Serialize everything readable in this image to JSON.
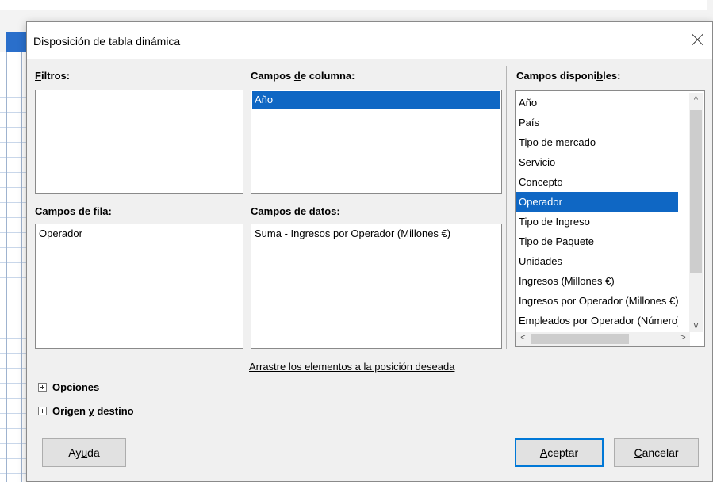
{
  "dialog": {
    "title": "Disposición de tabla dinámica",
    "close_label": "×"
  },
  "sections": {
    "filtros": {
      "pre": "",
      "u": "F",
      "post": "iltros:"
    },
    "columna": {
      "pre": "Campos ",
      "u": "d",
      "post": "e columna:"
    },
    "fila": {
      "pre": "Campos de fi",
      "u": "l",
      "post": "a:"
    },
    "datos": {
      "pre": "Ca",
      "u": "m",
      "post": "pos de datos:"
    },
    "disponibles": {
      "pre": "Campos disponi",
      "u": "b",
      "post": "les:"
    }
  },
  "column_fields": [
    "Año"
  ],
  "row_fields": [
    "Operador"
  ],
  "data_fields": [
    "Suma - Ingresos por Operador (Millones €)"
  ],
  "available_fields": [
    "Año",
    "País",
    "Tipo de mercado",
    "Servicio",
    "Concepto",
    "Operador",
    "Tipo de Ingreso",
    "Tipo de Paquete",
    "Unidades",
    "Ingresos (Millones €)",
    "Ingresos por Operador (Millones €)",
    "Empleados por Operador (Número)"
  ],
  "selected_available": "Operador",
  "hint": "Arrastre los elementos a la posición deseada",
  "expanders": {
    "opciones": {
      "pre": "",
      "u": "O",
      "post": "pciones"
    },
    "origen": {
      "pre": "Origen ",
      "u": "y",
      "post": " destino"
    }
  },
  "buttons": {
    "ayuda": {
      "pre": "Ay",
      "u": "u",
      "post": "da"
    },
    "aceptar": {
      "pre": "",
      "u": "A",
      "post": "ceptar"
    },
    "cancelar": {
      "pre": "",
      "u": "C",
      "post": "ancelar"
    }
  },
  "scroll_icons": {
    "up": "^",
    "down": "v",
    "left": "<",
    "right": ">"
  },
  "colors": {
    "selection": "#0f67c4",
    "primary_border": "#0078d7"
  }
}
